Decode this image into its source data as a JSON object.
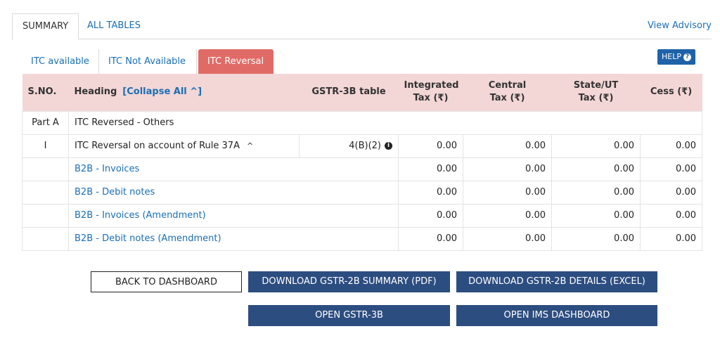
{
  "top_tabs": {
    "summary": "SUMMARY",
    "all_tables": "ALL TABLES",
    "advisory": "View Advisory"
  },
  "sub_tabs": {
    "available": "ITC available",
    "not_available": "ITC Not Available",
    "reversal": "ITC Reversal"
  },
  "help": {
    "label": "HELP",
    "icon": "?"
  },
  "table": {
    "headers": {
      "sno": "S.NO.",
      "heading": "Heading",
      "collapse": "[Collapse All ^]",
      "gstr": "GSTR-3B table",
      "integrated_1": "Integrated",
      "integrated_2": "Tax (₹)",
      "central_1": "Central",
      "central_2": "Tax (₹)",
      "state_1": "State/UT",
      "state_2": "Tax (₹)",
      "cess": "Cess (₹)"
    },
    "part": {
      "sno": "Part A",
      "heading": "ITC Reversed - Others"
    },
    "row_i": {
      "sno": "I",
      "heading": "ITC Reversal on account of Rule 37A",
      "chevron": "^",
      "table_ref": "4(B)(2)",
      "info": "i",
      "igst": "0.00",
      "cgst": "0.00",
      "sgst": "0.00",
      "cess": "0.00"
    },
    "subrows": [
      {
        "heading": "B2B - Invoices",
        "igst": "0.00",
        "cgst": "0.00",
        "sgst": "0.00",
        "cess": "0.00"
      },
      {
        "heading": "B2B - Debit notes",
        "igst": "0.00",
        "cgst": "0.00",
        "sgst": "0.00",
        "cess": "0.00"
      },
      {
        "heading": "B2B - Invoices (Amendment)",
        "igst": "0.00",
        "cgst": "0.00",
        "sgst": "0.00",
        "cess": "0.00"
      },
      {
        "heading": "B2B - Debit notes (Amendment)",
        "igst": "0.00",
        "cgst": "0.00",
        "sgst": "0.00",
        "cess": "0.00"
      }
    ]
  },
  "buttons": {
    "back": "BACK TO DASHBOARD",
    "download_pdf": "DOWNLOAD GSTR-2B SUMMARY (PDF)",
    "download_excel": "DOWNLOAD GSTR-2B DETAILS (EXCEL)",
    "open_3b": "OPEN GSTR-3B",
    "open_ims": "OPEN IMS DASHBOARD"
  },
  "colors": {
    "active_tab": "#e06b66",
    "header_bg": "#f3d6d6",
    "button_dark": "#2c4d80",
    "link": "#1a6fb5"
  }
}
